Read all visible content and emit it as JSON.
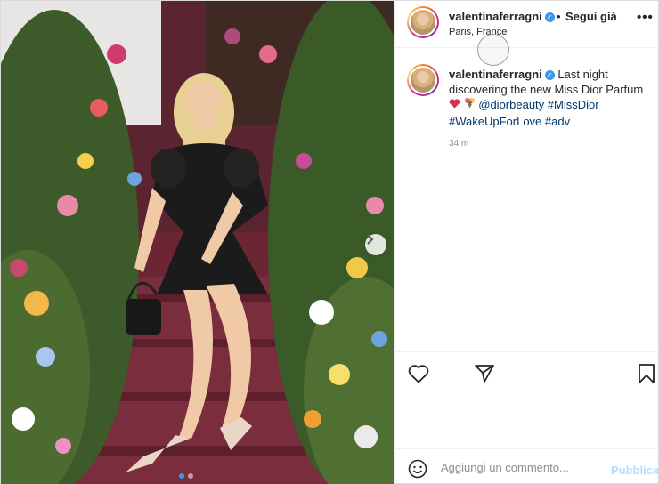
{
  "post": {
    "author": {
      "username": "valentinaferragni",
      "verified": true,
      "follow_label": "Segui già",
      "separator": "•",
      "location": "Paris, France"
    },
    "more_icon": "more-options-icon",
    "caption": {
      "username": "valentinaferragni",
      "text_line1": "Last night",
      "text_line2": "discovering the new Miss Dior Parfum",
      "emojis": [
        "heart-emoji",
        "bouquet-emoji"
      ],
      "mention": "@diorbeauty",
      "hashtag1": "#MissDior",
      "hashtag2": "#WakeUpForLove",
      "hashtag3": "#adv"
    },
    "time_ago": "34 m",
    "actions": {
      "like_icon": "heart-icon",
      "share_icon": "paper-plane-icon",
      "save_icon": "bookmark-icon"
    },
    "comment": {
      "placeholder": "Aggiungi un commento...",
      "publish_label": "Pubblica",
      "emoji_icon": "smiley-icon"
    },
    "carousel": {
      "slide_count": 2,
      "active_index": 0
    },
    "colors": {
      "link": "#00376b",
      "verified": "#3897f0",
      "muted": "#8e8e8e",
      "publish_disabled": "#b2dffc",
      "carpet": "#7a2d3c"
    }
  }
}
